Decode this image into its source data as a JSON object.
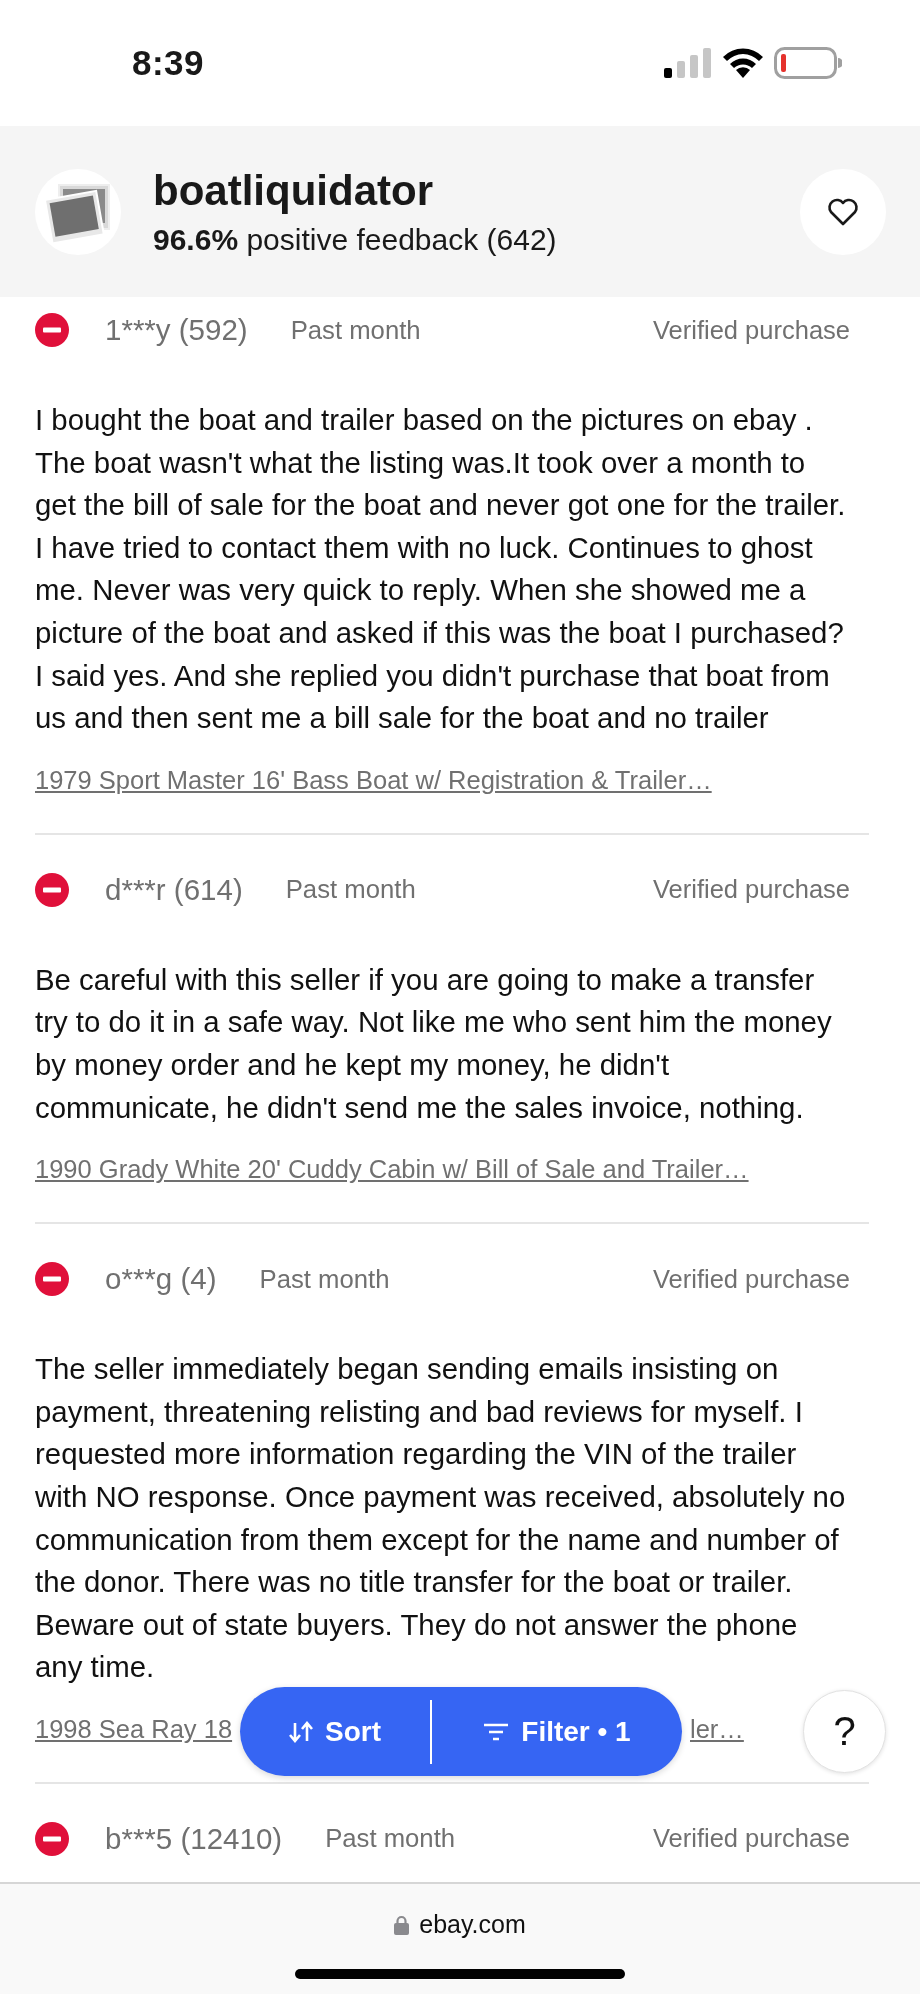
{
  "status_bar": {
    "time": "8:39"
  },
  "seller": {
    "name": "boatliquidator",
    "feedback_percent": "96.6%",
    "feedback_text": "positive feedback (642)"
  },
  "reviews": [
    {
      "kind": "negative",
      "user": "1***y (592)",
      "when": "Past month",
      "verified": "Verified purchase",
      "body": "I bought the boat and trailer based on the pictures on ebay . The boat wasn't what the listing was.It took over a month to get the bill of sale for the boat and never got one for the trailer. I have tried to contact them with no luck. Continues to ghost me. Never was very quick to reply. When she showed me a picture of the boat and asked if this was the boat I purchased? I said yes. And she replied you didn't purchase that boat from us and then sent me a bill sale for the boat and no trailer",
      "item_link": [
        "1979 Sport Master 16' Bass Boat w/ Registration & Trailer…"
      ]
    },
    {
      "kind": "negative",
      "user": "d***r (614)",
      "when": "Past month",
      "verified": "Verified purchase",
      "body": "Be careful with this seller if you are going to make a transfer try to do it in a safe way. Not like me who sent him the money by money order and he kept my money, he didn't communicate, he didn't send me the sales invoice, nothing.",
      "item_link": [
        "1990 Grady White 20' Cuddy Cabin w/ Bill of Sale and Trailer…"
      ]
    },
    {
      "kind": "negative",
      "user": "o***g (4)",
      "when": "Past month",
      "verified": "Verified purchase",
      "body": "The seller immediately began sending emails insisting on payment, threatening relisting and bad reviews for myself. I requested more information regarding the VIN of the trailer with NO response. Once payment was received, absolutely no communication from them except for the name and number of the donor. There was no title transfer for the boat or trailer. Beware out of state buyers. They do not answer the phone any time.",
      "item_link": [
        "1998 Sea Ray 18",
        "ler…"
      ]
    },
    {
      "kind": "negative",
      "user": "b***5 (12410)",
      "when": "Past month",
      "verified": "Verified purchase"
    }
  ],
  "actions": {
    "sort": "Sort",
    "filter": "Filter • 1"
  },
  "help": "?",
  "address_bar": {
    "domain": "ebay.com"
  }
}
